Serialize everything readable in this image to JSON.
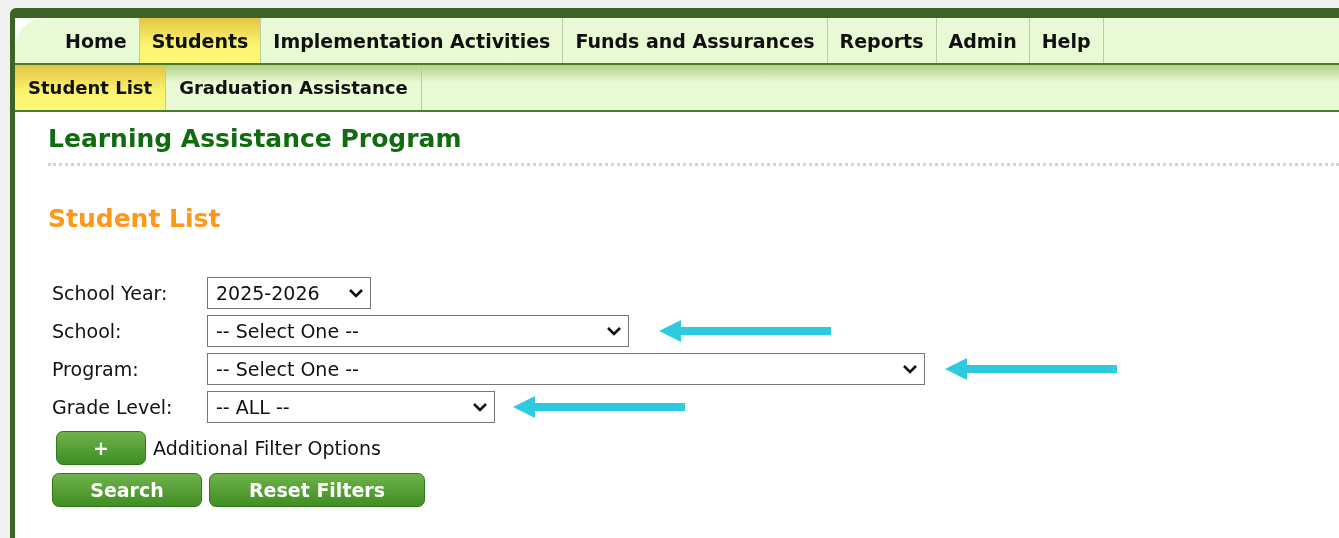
{
  "main_nav": [
    {
      "label": "Home",
      "selected": false
    },
    {
      "label": "Students",
      "selected": true
    },
    {
      "label": "Implementation Activities",
      "selected": false
    },
    {
      "label": "Funds and Assurances",
      "selected": false
    },
    {
      "label": "Reports",
      "selected": false
    },
    {
      "label": "Admin",
      "selected": false
    },
    {
      "label": "Help",
      "selected": false
    }
  ],
  "sub_nav": [
    {
      "label": "Student List",
      "selected": true
    },
    {
      "label": "Graduation Assistance",
      "selected": false
    }
  ],
  "page_title": "Learning Assistance Program",
  "section_title": "Student List",
  "filters": [
    {
      "label": "School Year:",
      "value": "2025-2026",
      "arrow": false
    },
    {
      "label": "School:",
      "value": "-- Select One --",
      "arrow": true
    },
    {
      "label": "Program:",
      "value": "-- Select One --",
      "arrow": true
    },
    {
      "label": "Grade Level:",
      "value": "-- ALL --",
      "arrow": true
    }
  ],
  "additional_filters": {
    "button": "+",
    "label": "Additional Filter Options"
  },
  "buttons": [
    "Search",
    "Reset Filters"
  ]
}
